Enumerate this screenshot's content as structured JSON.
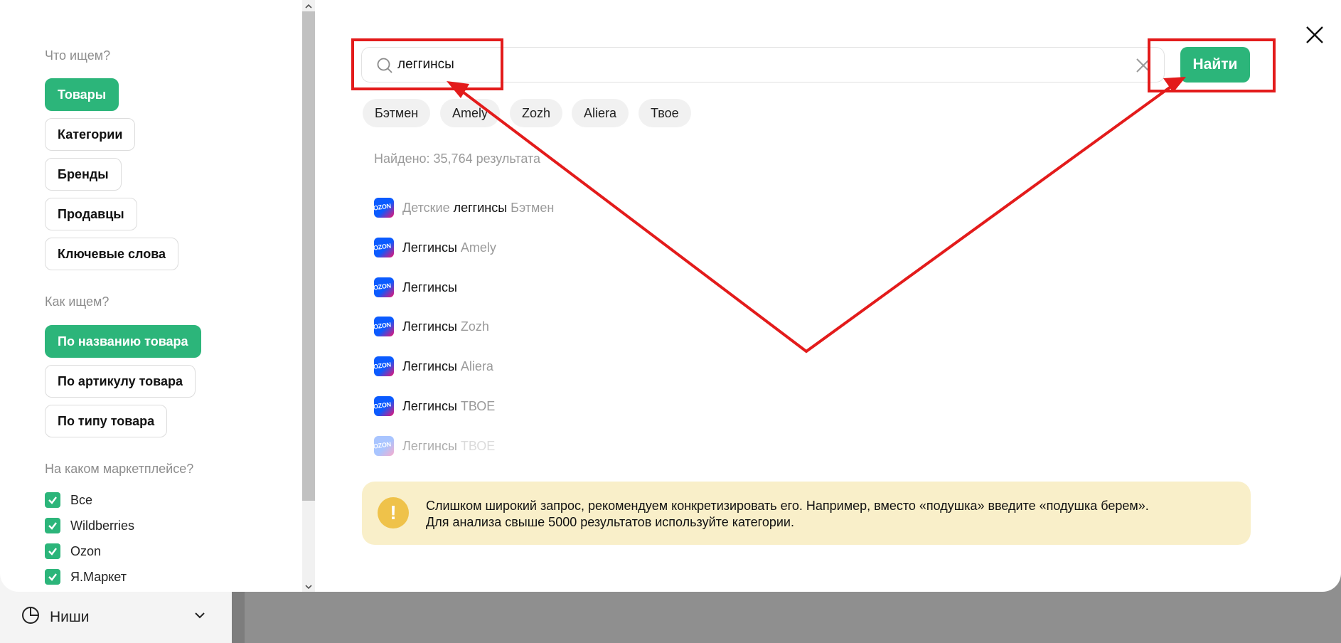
{
  "background": {
    "nav_label": "Ниши"
  },
  "filters": {
    "what_title": "Что ищем?",
    "what_options": [
      {
        "label": "Товары",
        "active": true
      },
      {
        "label": "Категории",
        "active": false
      },
      {
        "label": "Бренды",
        "active": false
      },
      {
        "label": "Продавцы",
        "active": false
      },
      {
        "label": "Ключевые слова",
        "active": false
      }
    ],
    "how_title": "Как ищем?",
    "how_options": [
      {
        "label": "По названию товара",
        "active": true
      },
      {
        "label": "По артикулу товара",
        "active": false
      },
      {
        "label": "По типу товара",
        "active": false
      }
    ],
    "market_title": "На каком маркетплейсе?",
    "markets": [
      {
        "label": "Все",
        "checked": true
      },
      {
        "label": "Wildberries",
        "checked": true
      },
      {
        "label": "Ozon",
        "checked": true
      },
      {
        "label": "Я.Маркет",
        "checked": true
      }
    ]
  },
  "search": {
    "value": "леггинсы",
    "find_label": "Найти",
    "suggestions": [
      "Бэтмен",
      "Amely",
      "Zozh",
      "Aliera",
      "Твое"
    ],
    "found_text": "Найдено: 35,764 результата"
  },
  "results": [
    {
      "pre": "Детские ",
      "main": "леггинсы",
      "post": " Бэтмен",
      "logo": "OZON"
    },
    {
      "pre": "",
      "main": "Леггинсы",
      "post": " Amely",
      "logo": "OZON"
    },
    {
      "pre": "",
      "main": "Леггинсы",
      "post": "",
      "logo": "OZON"
    },
    {
      "pre": "",
      "main": "Леггинсы",
      "post": " Zozh",
      "logo": "OZON"
    },
    {
      "pre": "",
      "main": "Леггинсы",
      "post": " Aliera",
      "logo": "OZON"
    },
    {
      "pre": "",
      "main": "Леггинсы",
      "post": " ТВОЕ",
      "logo": "OZON"
    },
    {
      "pre": "",
      "main": "Леггинсы",
      "post": " ТВОЕ",
      "logo": "OZON"
    }
  ],
  "warning": {
    "icon": "!",
    "line1": "Слишком широкий запрос, рекомендуем конкретизировать его. Например, вместо «подушка» введите «подушка берем».",
    "line2": "Для анализа свыше 5000 результатов используйте категории."
  },
  "colors": {
    "accent": "#2cb57a",
    "annotation": "#e31b1b",
    "warning_bg": "#f9efc9"
  }
}
